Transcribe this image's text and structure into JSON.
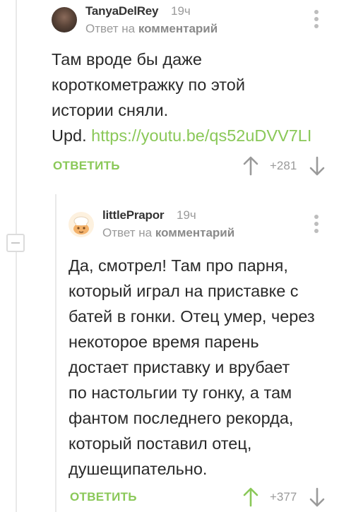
{
  "comments": [
    {
      "author": "TanyaDelRey",
      "time": "19ч",
      "reply_prefix": "Ответ на",
      "reply_target": "комментарий",
      "body_lines": [
        "Там вроде бы даже",
        "короткометражку по этой",
        "истории сняли."
      ],
      "upd_label": "Upd.",
      "link_text": "https://youtu.be/qs52uDVV7LI",
      "reply_label": "ОТВЕТИТЬ",
      "score": "+281",
      "vote_state": "none"
    },
    {
      "author": "littlePrapor",
      "time": "19ч",
      "reply_prefix": "Ответ на",
      "reply_target": "комментарий",
      "body_lines": [
        "Да, смотрел! Там про парня,",
        "который играл на приставке с",
        "батей в гонки. Отец умер, через",
        "некоторое время парень",
        "достает приставку и врубает",
        "по настольгии ту гонку, а там",
        "фантом последнего рекорда,",
        "который поставил отец,",
        "душещипательно."
      ],
      "reply_label": "ОТВЕТИТЬ",
      "score": "+377",
      "vote_state": "upvoted"
    }
  ],
  "colors": {
    "accent_green": "#8ac858",
    "muted_gray": "#9a9a9a",
    "arrow_gray": "#9a9a9a"
  },
  "icons": {
    "upvote": "arrow-up-icon",
    "downvote": "arrow-down-icon",
    "more": "more-vertical-icon",
    "collapse": "collapse-minus-icon"
  }
}
